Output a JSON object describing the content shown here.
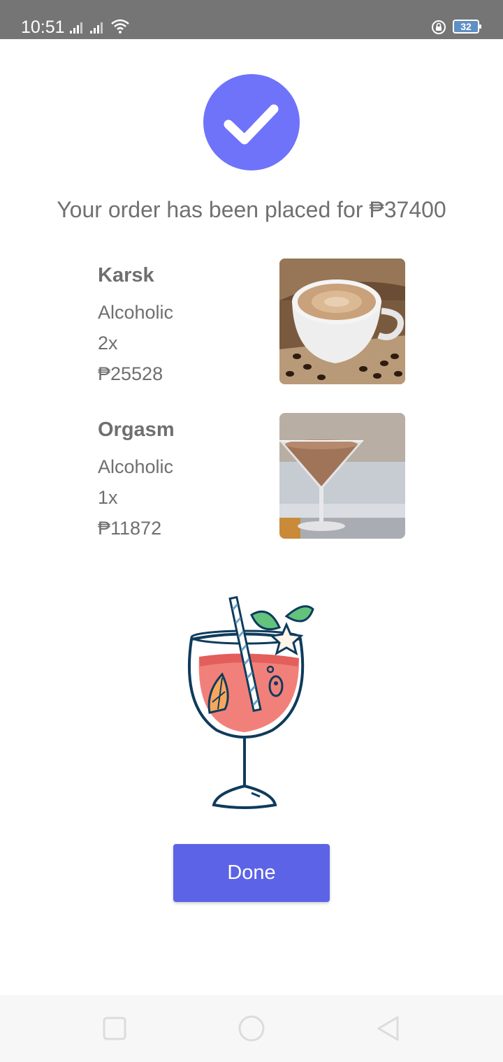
{
  "status_bar": {
    "time": "10:51",
    "battery_level": "32",
    "icons": [
      "signal-icon",
      "signal-icon",
      "wifi-icon",
      "rotation-lock-icon",
      "battery-icon"
    ]
  },
  "confirmation": {
    "icon": "checkmark-icon",
    "accent_color": "#6f73f9",
    "message": "Your order has been placed for ₱37400"
  },
  "order_items": [
    {
      "name": "Karsk",
      "category": "Alcoholic",
      "quantity": "2x",
      "price": "₱25528",
      "image": "coffee-cup-photo"
    },
    {
      "name": "Orgasm",
      "category": "Alcoholic",
      "quantity": "1x",
      "price": "₱11872",
      "image": "cocktail-glass-photo"
    }
  ],
  "illustration": "cocktail-glass-illustration",
  "done_button": {
    "label": "Done",
    "color": "#5d63e6"
  },
  "nav_bar": {
    "buttons": [
      "recent-apps-icon",
      "home-icon",
      "back-icon"
    ]
  }
}
